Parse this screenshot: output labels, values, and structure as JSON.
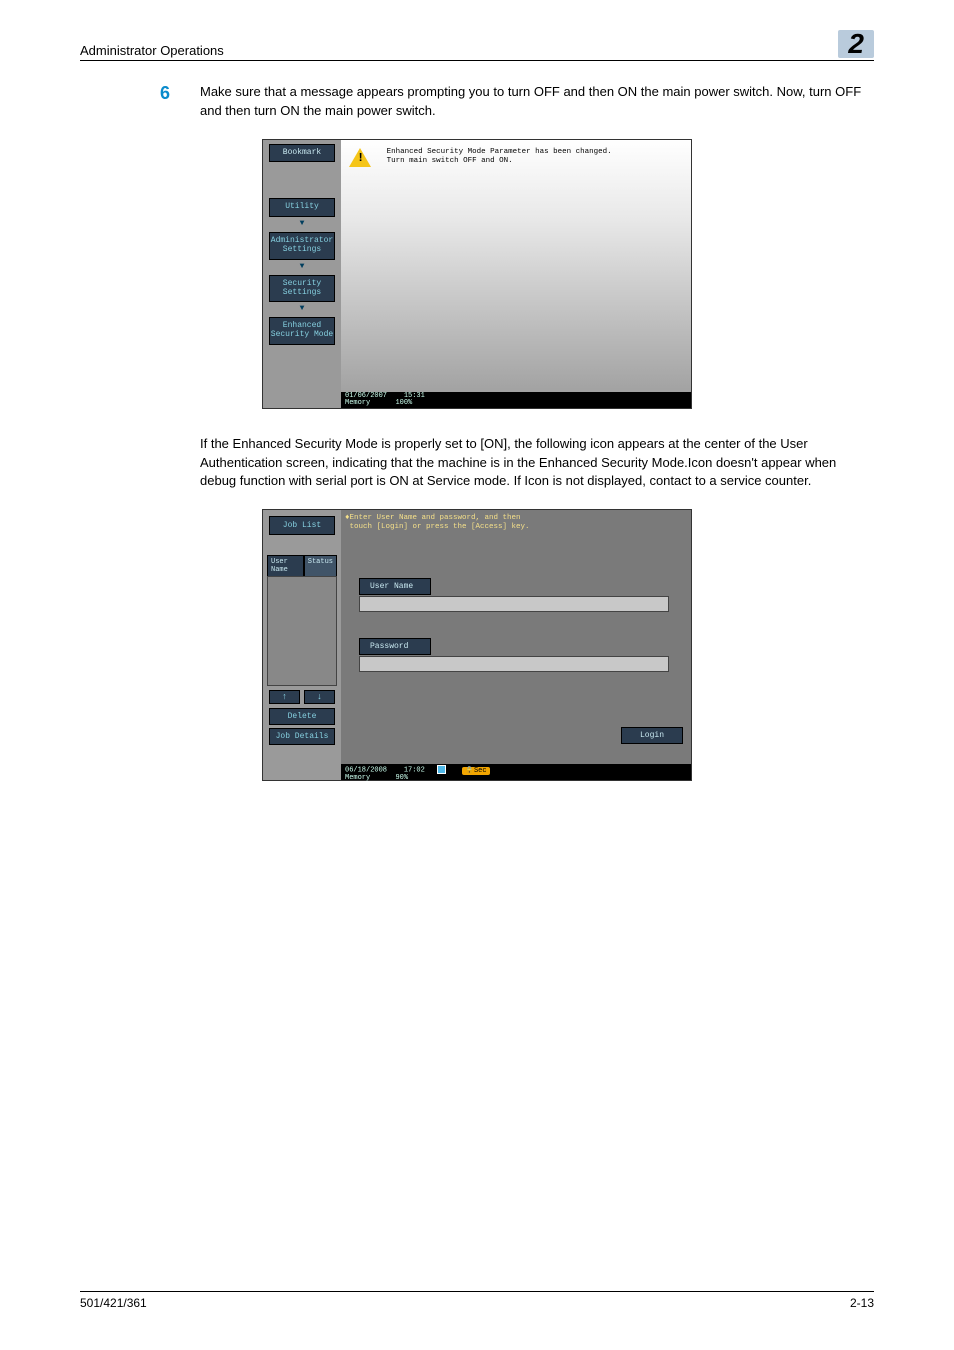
{
  "header": {
    "title": "Administrator Operations",
    "chapter": "2"
  },
  "step": {
    "number": "6",
    "text": "Make sure that a message appears prompting you to turn OFF and then ON the main power switch. Now, turn OFF and then turn ON the main power switch."
  },
  "screenshot1": {
    "breadcrumb": [
      "Bookmark",
      "Utility",
      "Administrator Settings",
      "Security Settings",
      "Enhanced Security Mode"
    ],
    "warning_line1": "Enhanced Security Mode Parameter has been changed.",
    "warning_line2": "Turn main switch OFF and ON.",
    "status_date": "01/06/2007",
    "status_time": "15:31",
    "status_mem_label": "Memory",
    "status_mem_val": "100%"
  },
  "paragraph": "If the Enhanced Security Mode is properly set to [ON], the following icon appears at the center of the User Authentication screen, indicating that the machine is in the Enhanced Security Mode.Icon doesn't appear when debug function with serial port is ON at Service mode. If Icon is not displayed, contact to a service counter.",
  "screenshot2": {
    "joblist": "Job List",
    "tabs": [
      "User Name",
      "Status"
    ],
    "delete": "Delete",
    "jobdetails": "Job Details",
    "prompt_line1": "Enter User Name and password, and then",
    "prompt_line2": "touch [Login] or press the [Access] key.",
    "username_label": "User Name",
    "password_label": "Password",
    "login": "Login",
    "status_date": "06/18/2008",
    "status_time": "17:02",
    "status_mem_label": "Memory",
    "status_mem_val": "90%",
    "sec_badge": "Sec"
  },
  "footer": {
    "left": "501/421/361",
    "right": "2-13"
  }
}
